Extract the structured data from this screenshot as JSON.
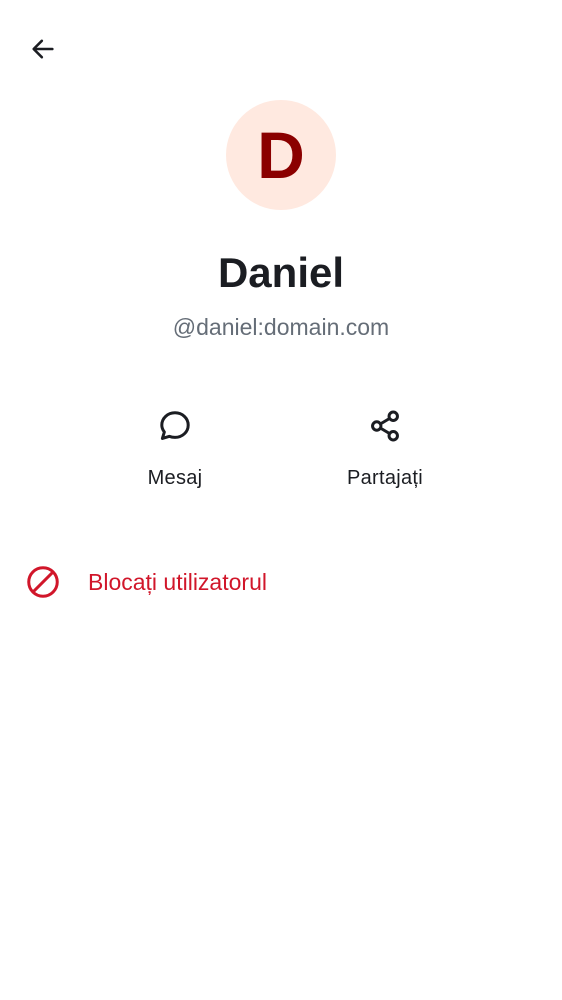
{
  "header": {
    "back_icon": "arrow-left-icon"
  },
  "profile": {
    "avatar_initial": "D",
    "display_name": "Daniel",
    "user_id": "@daniel:domain.com"
  },
  "actions": [
    {
      "label": "Mesaj",
      "icon": "chat-bubble-icon"
    },
    {
      "label": "Partajați",
      "icon": "share-icon"
    }
  ],
  "block_user": {
    "label": "Blocați utilizatorul",
    "icon": "block-icon"
  },
  "colors": {
    "avatar_background": "#ffe9e0",
    "avatar_text": "#8b0000",
    "primary_text": "#1b1d22",
    "secondary_text": "#656d77",
    "critical": "#d1162a"
  }
}
